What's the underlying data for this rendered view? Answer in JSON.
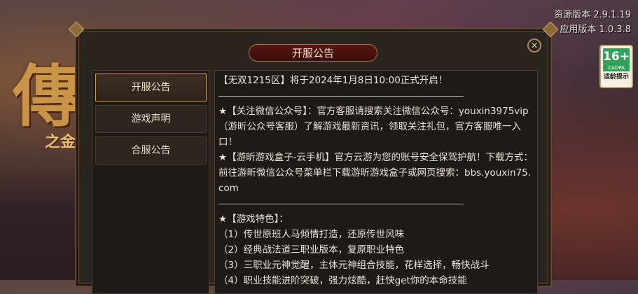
{
  "background": {
    "logo_char": "傳",
    "logo_sub": "之金"
  },
  "version": {
    "resource": "资源版本 2.9.1.19",
    "app": "应用版本 1.0.3.8"
  },
  "age_badge": {
    "number": "16+",
    "org": "CADPA",
    "tip": "适龄提示"
  },
  "dialog": {
    "title": "开服公告",
    "close_label": "×",
    "tabs": [
      {
        "label": "开服公告",
        "active": true
      },
      {
        "label": "游戏声明",
        "active": false
      },
      {
        "label": "合服公告",
        "active": false
      }
    ],
    "content": {
      "line0": "【无双1215区】将于2024年1月8日10:00正式开启！",
      "line1": "★【关注微信公众号】：官方客服请搜索关注微信公众号：youxin3975vip（游昕公众号客服）了解游戏最新资讯，领取关注礼包，官方客服唯一入口！",
      "line2": "★【游昕游戏盒子-云手机】官方云游为您的账号安全保驾护航！下载方式：前往游昕微信公众号菜单栏下载游昕游戏盒子或网页搜索：bbs.youxin75.com",
      "line3": "★【游戏特色】：",
      "line4": "（1）传世原班人马倾情打造，还原传世风味",
      "line5": "（2）经典战法道三职业版本，复原职业特色",
      "line6": "（3）三职业元神觉醒，主体元神组合技能，花样选择，畅快战斗",
      "line7": "（4）职业技能进阶突破，强力炫酷，赶快get你的本命技能"
    }
  }
}
